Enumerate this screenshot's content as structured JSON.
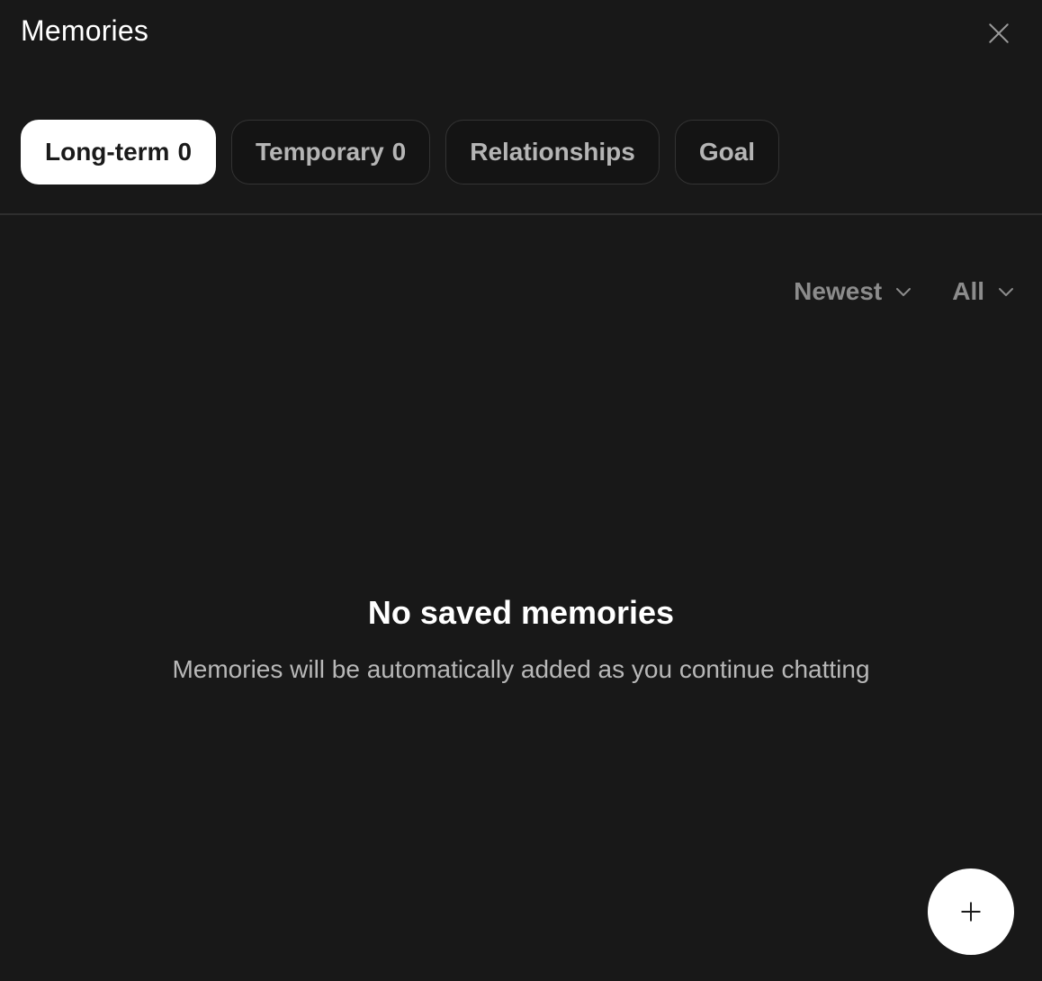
{
  "header": {
    "title": "Memories",
    "close_icon": "close-icon"
  },
  "tabs": [
    {
      "label": "Long-term",
      "count": "0",
      "active": true
    },
    {
      "label": "Temporary",
      "count": "0",
      "active": false
    },
    {
      "label": "Relationships",
      "count": "",
      "active": false
    },
    {
      "label": "Goal",
      "count": "",
      "active": false
    }
  ],
  "filters": {
    "sort": {
      "label": "Newest",
      "icon": "chevron-down-icon"
    },
    "scope": {
      "label": "All",
      "icon": "chevron-down-icon"
    }
  },
  "empty_state": {
    "title": "No saved memories",
    "subtitle": "Memories will be automatically added as you continue chatting"
  },
  "fab": {
    "icon": "plus-icon"
  },
  "colors": {
    "background": "#181818",
    "active_tab_bg": "#ffffff",
    "inactive_tab_text": "#b5b5b5",
    "filter_text": "#8c8c8c"
  }
}
